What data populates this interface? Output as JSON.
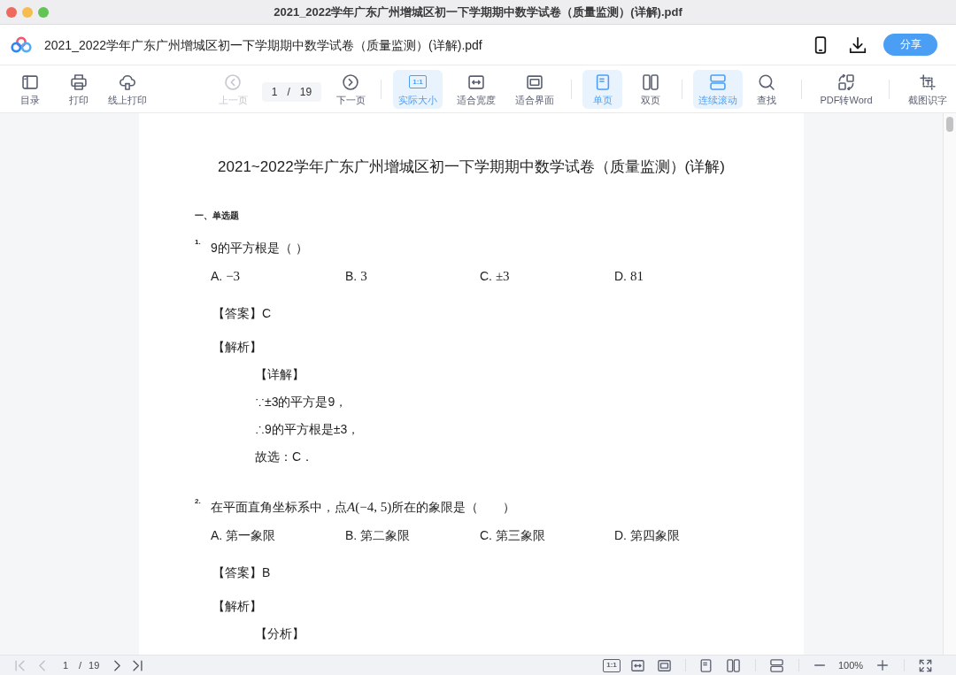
{
  "window": {
    "title": "2021_2022学年广东广州增城区初一下学期期中数学试卷（质量监测）(详解).pdf"
  },
  "header": {
    "file_name": "2021_2022学年广东广州增城区初一下学期期中数学试卷（质量监测）(详解).pdf",
    "share_button": "分享"
  },
  "toolbar": {
    "groups": [
      {
        "items": [
          {
            "kind": "button",
            "label": "目录",
            "selected": false,
            "disabled": false
          },
          {
            "kind": "button",
            "label": "打印",
            "selected": false,
            "disabled": false
          },
          {
            "kind": "button",
            "label": "线上打印",
            "selected": false,
            "disabled": false
          },
          {
            "kind": "button",
            "label": "上一页",
            "selected": false,
            "disabled": true
          },
          {
            "kind": "page_field",
            "value": "1",
            "slash": "/",
            "total": "19"
          },
          {
            "kind": "button",
            "label": "下一页",
            "selected": false,
            "disabled": false
          }
        ]
      },
      {
        "items": [
          {
            "kind": "button",
            "label": "实际大小",
            "icon_text": "1:1",
            "selected": true,
            "disabled": false
          },
          {
            "kind": "button",
            "label": "适合宽度",
            "selected": false,
            "disabled": false
          },
          {
            "kind": "button",
            "label": "适合界面",
            "selected": false,
            "disabled": false
          }
        ]
      },
      {
        "items": [
          {
            "kind": "button",
            "label": "单页",
            "selected": true,
            "disabled": false
          },
          {
            "kind": "button",
            "label": "双页",
            "selected": false,
            "disabled": false
          }
        ]
      },
      {
        "items": [
          {
            "kind": "button",
            "label": "连续滚动",
            "selected": true,
            "disabled": false
          },
          {
            "kind": "button",
            "label": "查找",
            "selected": false,
            "disabled": false
          }
        ]
      },
      {
        "items": [
          {
            "kind": "button",
            "label": "PDF转Word",
            "selected": false,
            "disabled": false
          }
        ]
      },
      {
        "items": [
          {
            "kind": "button",
            "label": "截图识字",
            "selected": false,
            "disabled": false
          }
        ]
      }
    ]
  },
  "document": {
    "title": "2021~2022学年广东广州增城区初一下学期期中数学试卷（质量监测）(详解)",
    "sections": [
      {
        "heading": "一、单选题",
        "questions": [
          {
            "number": "1.",
            "stem": [
              {
                "kind": "text",
                "text": "9的平方根是（ ）"
              }
            ],
            "options": [
              {
                "letter": "A.",
                "value": "−3",
                "kind": "math"
              },
              {
                "letter": "B.",
                "value": "3",
                "kind": "math"
              },
              {
                "letter": "C.",
                "value": "±3",
                "kind": "math"
              },
              {
                "letter": "D.",
                "value": "81",
                "kind": "math"
              }
            ],
            "answer": "【答案】C",
            "analysis": "【解析】",
            "details": [
              "【详解】",
              "∵±3的平方是9，",
              "∴9的平方根是±3，",
              "故选：C．"
            ]
          },
          {
            "number": "2.",
            "stem": [
              {
                "kind": "text",
                "text": "在平面直角坐标系中，点"
              },
              {
                "kind": "variable",
                "text": "A"
              },
              {
                "kind": "math",
                "text": "(−4, 5)"
              },
              {
                "kind": "text",
                "text": "所在的象限是（　　）"
              }
            ],
            "options": [
              {
                "letter": "A.",
                "value": "第一象限",
                "kind": "text"
              },
              {
                "letter": "B.",
                "value": "第二象限",
                "kind": "text"
              },
              {
                "letter": "C.",
                "value": "第三象限",
                "kind": "text"
              },
              {
                "letter": "D.",
                "value": "第四象限",
                "kind": "text"
              }
            ],
            "answer": "【答案】B",
            "analysis": "【解析】",
            "details": [
              "【分析】"
            ]
          }
        ]
      }
    ]
  },
  "bottom_bar": {
    "nav": [
      {
        "disabled": true
      },
      {
        "disabled": true
      },
      {
        "disabled": false
      },
      {
        "disabled": false
      }
    ],
    "page": {
      "value": "1",
      "slash": "/",
      "total": "19"
    },
    "actual_size_icon_text": "1:1",
    "zoom": "100%"
  }
}
